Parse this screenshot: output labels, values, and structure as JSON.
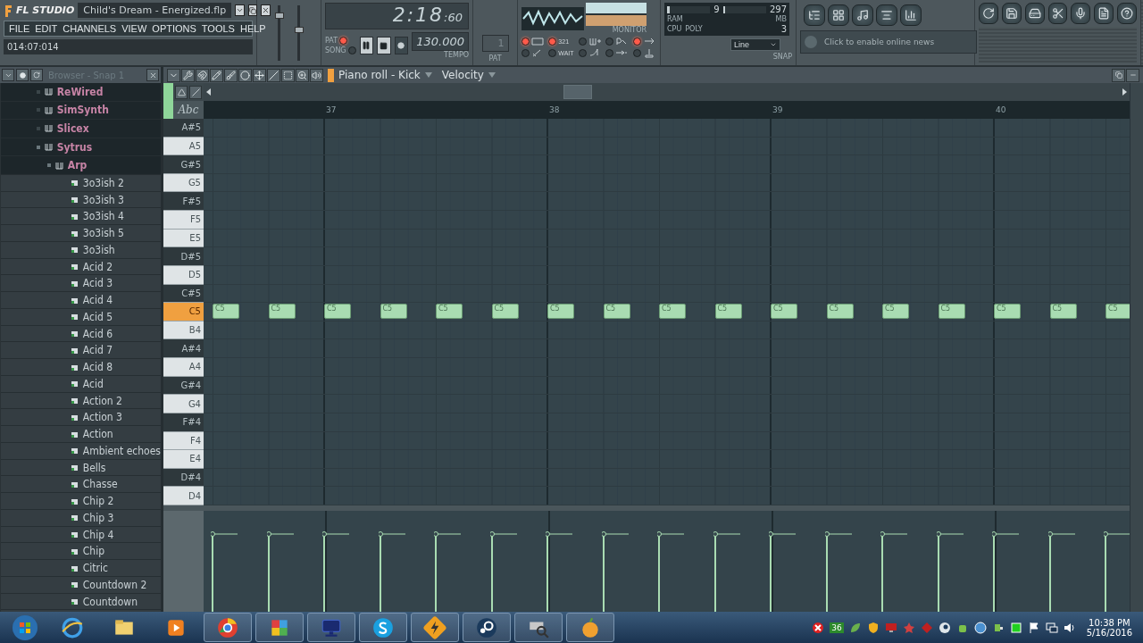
{
  "title_bar": {
    "logo": "FL STUDIO",
    "title": "Child's Dream - Energized.flp"
  },
  "menu": [
    "FILE",
    "EDIT",
    "CHANNELS",
    "VIEW",
    "OPTIONS",
    "TOOLS",
    "HELP"
  ],
  "hint": "014:07:014",
  "sliders": [
    {
      "level": 0.85
    },
    {
      "level": 0.55
    }
  ],
  "time": {
    "main": "2:18",
    "small": ":60"
  },
  "modes": [
    {
      "label": "PAT",
      "selected": true
    },
    {
      "label": "SONG",
      "selected": false
    }
  ],
  "tempo": {
    "value": "130.000",
    "label": "TEMPO"
  },
  "pattern": {
    "value": "1",
    "label": "PAT"
  },
  "monitor_label": "MONITOR",
  "toggles": [
    {
      "on": true
    },
    {
      "on": true,
      "label": "321"
    },
    {
      "on": false
    },
    {
      "on": false
    },
    {
      "on": true
    },
    {
      "on": false
    },
    {
      "on": false,
      "label": "WAIT"
    },
    {
      "on": false
    },
    {
      "on": false
    },
    {
      "on": false
    }
  ],
  "cpu": {
    "ram": "9",
    "mb": "297",
    "ram_label": "RAM",
    "mb_label": "MB",
    "cpu_label": "CPU",
    "poly_label": "POLY",
    "poly": "3",
    "meters": [
      {
        "level": 0.06
      },
      {
        "level": 0.04
      }
    ]
  },
  "snap": {
    "value": "Line",
    "label": "SNAP"
  },
  "news": {
    "placeholder": "Click to enable online news"
  },
  "browser": {
    "title": "Browser - Snap 1",
    "tree": [
      {
        "label": "ReWired",
        "kind": "plugin",
        "expanded": false
      },
      {
        "label": "SimSynth",
        "kind": "plugin",
        "expanded": false
      },
      {
        "label": "Slicex",
        "kind": "plugin",
        "expanded": false
      },
      {
        "label": "Sytrus",
        "kind": "plugin",
        "expanded": true,
        "children": [
          {
            "label": "Arp",
            "kind": "plugin",
            "expanded": true,
            "children": [
              {
                "label": "3o3ish 2",
                "kind": "preset"
              },
              {
                "label": "3o3ish 3",
                "kind": "preset"
              },
              {
                "label": "3o3ish 4",
                "kind": "preset"
              },
              {
                "label": "3o3ish 5",
                "kind": "preset"
              },
              {
                "label": "3o3ish",
                "kind": "preset"
              },
              {
                "label": "Acid 2",
                "kind": "preset"
              },
              {
                "label": "Acid 3",
                "kind": "preset"
              },
              {
                "label": "Acid 4",
                "kind": "preset"
              },
              {
                "label": "Acid 5",
                "kind": "preset"
              },
              {
                "label": "Acid 6",
                "kind": "preset"
              },
              {
                "label": "Acid 7",
                "kind": "preset"
              },
              {
                "label": "Acid 8",
                "kind": "preset"
              },
              {
                "label": "Acid",
                "kind": "preset"
              },
              {
                "label": "Action 2",
                "kind": "preset"
              },
              {
                "label": "Action 3",
                "kind": "preset"
              },
              {
                "label": "Action",
                "kind": "preset"
              },
              {
                "label": "Ambient echoes",
                "kind": "preset"
              },
              {
                "label": "Bells",
                "kind": "preset"
              },
              {
                "label": "Chasse",
                "kind": "preset"
              },
              {
                "label": "Chip 2",
                "kind": "preset"
              },
              {
                "label": "Chip 3",
                "kind": "preset"
              },
              {
                "label": "Chip 4",
                "kind": "preset"
              },
              {
                "label": "Chip",
                "kind": "preset"
              },
              {
                "label": "Citric",
                "kind": "preset"
              },
              {
                "label": "Countdown 2",
                "kind": "preset"
              },
              {
                "label": "Countdown",
                "kind": "preset"
              }
            ]
          }
        ]
      }
    ]
  },
  "piano_roll": {
    "title": "Piano roll - Kick",
    "view": "Velocity",
    "label_tool": "Abc",
    "ruler": [
      "37",
      "38",
      "39",
      "40"
    ],
    "keys": [
      {
        "label": "A#5",
        "kind": "black",
        "selected": false
      },
      {
        "label": "A5",
        "kind": "white",
        "selected": false
      },
      {
        "label": "G#5",
        "kind": "black",
        "selected": false
      },
      {
        "label": "G5",
        "kind": "white",
        "selected": false
      },
      {
        "label": "F#5",
        "kind": "black",
        "selected": false
      },
      {
        "label": "F5",
        "kind": "white",
        "selected": false
      },
      {
        "label": "E5",
        "kind": "white",
        "selected": false
      },
      {
        "label": "D#5",
        "kind": "black",
        "selected": false
      },
      {
        "label": "D5",
        "kind": "white",
        "selected": false
      },
      {
        "label": "C#5",
        "kind": "black",
        "selected": false
      },
      {
        "label": "C5",
        "kind": "white",
        "selected": true,
        "notes": [
          "C5",
          "C5",
          "C5",
          "C5",
          "C5",
          "C5",
          "C5",
          "C5",
          "C5",
          "C5",
          "C5",
          "C5",
          "C5",
          "C5",
          "C5",
          "C5",
          "C5"
        ]
      },
      {
        "label": "B4",
        "kind": "white",
        "selected": false
      },
      {
        "label": "A#4",
        "kind": "black",
        "selected": false
      },
      {
        "label": "A4",
        "kind": "white",
        "selected": false
      },
      {
        "label": "G#4",
        "kind": "black",
        "selected": false
      },
      {
        "label": "G4",
        "kind": "white",
        "selected": false
      },
      {
        "label": "F#4",
        "kind": "black",
        "selected": false
      },
      {
        "label": "F4",
        "kind": "white",
        "selected": false
      },
      {
        "label": "E4",
        "kind": "white",
        "selected": false
      },
      {
        "label": "D#4",
        "kind": "black",
        "selected": false
      },
      {
        "label": "D4",
        "kind": "white",
        "selected": false
      }
    ]
  },
  "taskbar": {
    "badge": "36",
    "time": "10:38 PM",
    "date": "5/16/2016"
  }
}
